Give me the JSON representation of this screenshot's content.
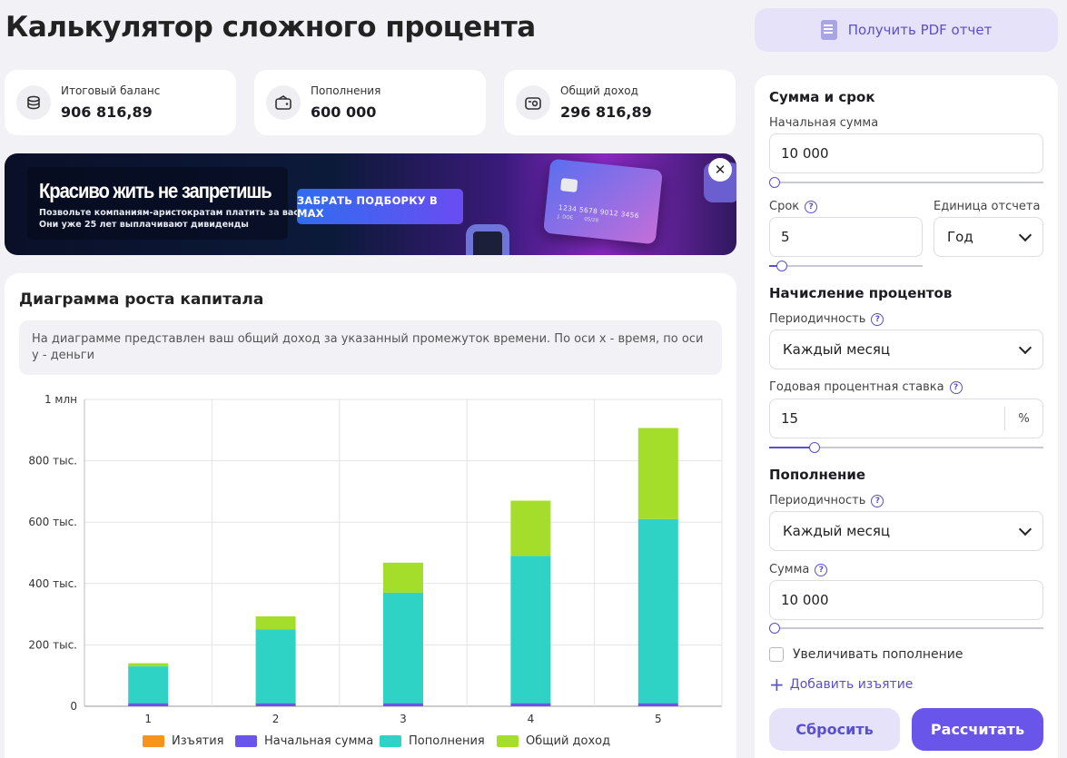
{
  "page_title": "Калькулятор сложного процента",
  "pdf_button": "Получить PDF отчет",
  "stats": [
    {
      "label": "Итоговый баланс",
      "value": "906 816,89",
      "icon": "coins-icon"
    },
    {
      "label": "Пополнения",
      "value": "600 000",
      "icon": "wallet-icon"
    },
    {
      "label": "Общий доход",
      "value": "296 816,89",
      "icon": "income-icon"
    }
  ],
  "banner": {
    "headline": "Красиво жить не запретишь",
    "subtext": "Позвольте компаниям-аристократам платить за вас. Они уже 25 лет выплачивают дивиденды",
    "cta": "ЗАБРАТЬ ПОДБОРКУ В MAX",
    "card_number": "1234 5678 9012 3456",
    "card_name": "J. DOE",
    "card_exp": "05/28",
    "close": "✕"
  },
  "chart_section": {
    "title": "Диаграмма роста капитала",
    "description": "На диаграмме представлен ваш общий доход за указанный промежуток времени. По оси x - время, по оси y - деньги"
  },
  "chart_data": {
    "type": "bar",
    "stacked": true,
    "categories": [
      "1",
      "2",
      "3",
      "4",
      "5"
    ],
    "y_tick_labels": [
      "0",
      "200 тыс.",
      "400 тыс.",
      "600 тыс.",
      "800 тыс.",
      "1 млн"
    ],
    "ylim": [
      0,
      1000000
    ],
    "grid": true,
    "legend_position": "bottom",
    "series": [
      {
        "name": "Изъятия",
        "color": "#f7941d",
        "values": [
          0,
          0,
          0,
          0,
          0
        ]
      },
      {
        "name": "Начальная сумма",
        "color": "#6a55ea",
        "values": [
          10000,
          10000,
          10000,
          10000,
          10000
        ]
      },
      {
        "name": "Пополнения",
        "color": "#2fd3c6",
        "values": [
          120000,
          240000,
          360000,
          480000,
          600000
        ]
      },
      {
        "name": "Общий доход",
        "color": "#a4de2a",
        "values": [
          10200,
          43000,
          98000,
          180000,
          296817
        ]
      }
    ]
  },
  "form": {
    "section_amount": "Сумма и срок",
    "initial_label": "Начальная сумма",
    "initial_value": "10 000",
    "initial_slider": 0.0,
    "term_label": "Срок",
    "term_value": "5",
    "term_slider": 0.05,
    "unit_label": "Единица отсчета",
    "unit_value": "Год",
    "section_interest": "Начисление процентов",
    "interest_freq_label": "Периодичность",
    "interest_freq_value": "Каждый месяц",
    "rate_label": "Годовая процентная ставка",
    "rate_value": "15",
    "rate_unit": "%",
    "rate_slider": 0.15,
    "section_topup": "Пополнение",
    "topup_freq_label": "Периодичность",
    "topup_freq_value": "Каждый месяц",
    "topup_sum_label": "Сумма",
    "topup_sum_value": "10 000",
    "topup_slider": 0.0,
    "increase_label": "Увеличивать пополнение",
    "add_withdrawal": "Добавить изъятие",
    "reset": "Сбросить",
    "calculate": "Рассчитать",
    "help": "?"
  }
}
